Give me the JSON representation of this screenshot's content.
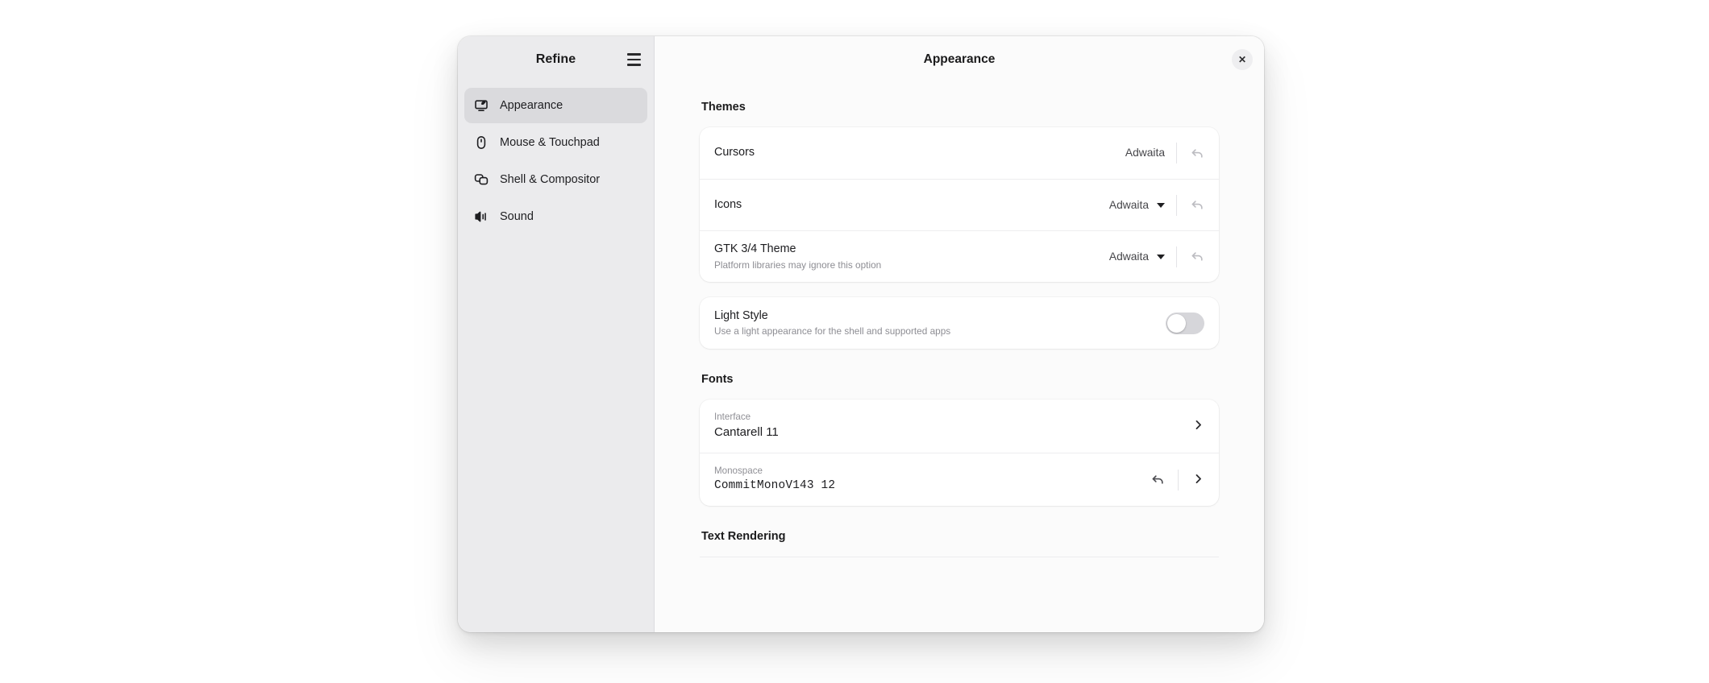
{
  "window": {
    "app_title": "Refine",
    "page_title": "Appearance",
    "menu_icon": "hamburger-menu-icon",
    "close_icon": "close-icon",
    "close_label": "✕"
  },
  "sidebar": {
    "items": [
      {
        "label": "Appearance",
        "icon": "display-appearance-icon",
        "selected": true
      },
      {
        "label": "Mouse & Touchpad",
        "icon": "mouse-icon",
        "selected": false
      },
      {
        "label": "Shell & Compositor",
        "icon": "windows-stack-icon",
        "selected": false
      },
      {
        "label": "Sound",
        "icon": "speaker-icon",
        "selected": false
      }
    ]
  },
  "main": {
    "sections": [
      {
        "title": "Themes",
        "rows": [
          {
            "title": "Cursors",
            "subtitle": "",
            "value": "Adwaita",
            "has_caret": false,
            "reset_icon": "undo-arrow-icon",
            "reset_enabled": false
          },
          {
            "title": "Icons",
            "subtitle": "",
            "value": "Adwaita",
            "has_caret": true,
            "reset_icon": "undo-arrow-icon",
            "reset_enabled": false
          },
          {
            "title": "GTK 3/4 Theme",
            "subtitle": "Platform libraries may ignore this option",
            "value": "Adwaita",
            "has_caret": true,
            "reset_icon": "undo-arrow-icon",
            "reset_enabled": false
          }
        ],
        "toggle_row": {
          "title": "Light Style",
          "subtitle": "Use a light appearance for the shell and supported apps",
          "toggle_state": "off"
        }
      },
      {
        "title": "Fonts",
        "font_rows": [
          {
            "label": "Interface",
            "value": "Cantarell 11",
            "monospace": false,
            "has_reset": false,
            "chevron_icon": "chevron-right-icon"
          },
          {
            "label": "Monospace",
            "value": "CommitMonoV143 12",
            "monospace": true,
            "has_reset": true,
            "reset_icon": "undo-arrow-icon",
            "chevron_icon": "chevron-right-icon"
          }
        ]
      },
      {
        "title": "Text Rendering"
      }
    ]
  },
  "colors": {
    "sidebar_bg": "#ebebed",
    "content_bg": "#fbfbfb",
    "card_bg": "#ffffff",
    "selected_item_bg": "#dadadd",
    "toggle_off_track": "#d6d6da",
    "text_primary": "#1c1c1f",
    "text_muted": "#8d8d93"
  }
}
